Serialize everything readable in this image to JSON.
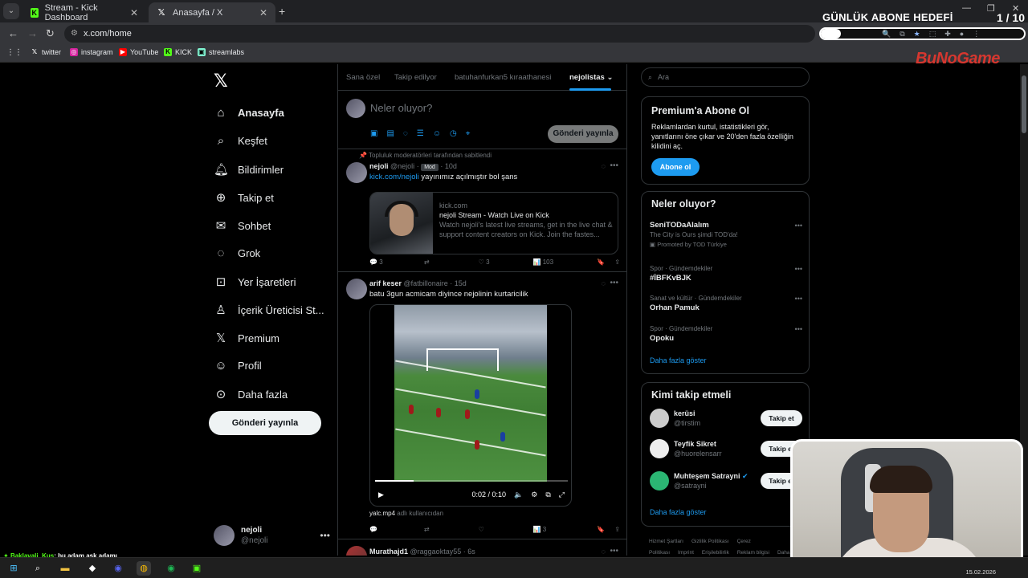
{
  "browser": {
    "tabs": [
      {
        "title": "Stream - Kick Dashboard",
        "favicon": "kick-icon"
      },
      {
        "title": "Anasayfa / X",
        "favicon": "x-icon"
      }
    ],
    "url": "x.com/home",
    "bookmarks": [
      "twitter",
      "instagram",
      "YouTube",
      "KICK",
      "streamlabs"
    ]
  },
  "overlay": {
    "goal_title": "GÜNLÜK ABONE HEDEFİ",
    "goal_count": "1 / 10",
    "goal_progress": 0.1,
    "brand": "BuNoGame",
    "chat_user": "Baklavali_Kus",
    "chat_message": ": bu adam aşk adamı"
  },
  "nav": {
    "items": [
      {
        "label": "Anasayfa",
        "icon": "home-icon"
      },
      {
        "label": "Keşfet",
        "icon": "search-icon"
      },
      {
        "label": "Bildirimler",
        "icon": "bell-icon"
      },
      {
        "label": "Takip et",
        "icon": "follow-icon"
      },
      {
        "label": "Sohbet",
        "icon": "mail-icon"
      },
      {
        "label": "Grok",
        "icon": "grok-icon"
      },
      {
        "label": "Yer İşaretleri",
        "icon": "bookmark-icon"
      },
      {
        "label": "İçerik Üreticisi St...",
        "icon": "creator-icon"
      },
      {
        "label": "Premium",
        "icon": "x-premium-icon"
      },
      {
        "label": "Profil",
        "icon": "person-icon"
      },
      {
        "label": "Daha fazla",
        "icon": "more-circle-icon"
      }
    ],
    "post_button": "Gönderi yayınla",
    "me_name": "nejoli",
    "me_handle": "@nejoli"
  },
  "feed": {
    "tabs": [
      "Sana özel",
      "Takip edilyor",
      "batuhanfurkan5 kıraathanesi",
      "nejolistas"
    ],
    "composer_placeholder": "Neler oluyor?",
    "composer_button": "Gönderi yayınla",
    "tweet1": {
      "pinned": "Topluluk moderatörleri tarafından sabitlendi",
      "name": "nejoli",
      "handle": "@nejoli",
      "badge": "Mod",
      "time": "· 10d",
      "link": "kick.com/nejoli",
      "text": " yayınımız açılmıştır bol şans",
      "card_domain": "kick.com",
      "card_title": "nejoli Stream - Watch Live on Kick",
      "card_desc": "Watch nejoli's latest live streams, get in the live chat & support content creators on Kick. Join the fastes...",
      "replies": "3",
      "reposts": "",
      "likes": "3",
      "views": "103"
    },
    "tweet2": {
      "name": "arif keser",
      "handle": "@fatbillonaire",
      "time": "· 15d",
      "text": "batu 3gun acmicam diyince nejolinin kurtaricilik",
      "video_time": "0:02 / 0:10",
      "video_progress": 0.2,
      "caption_file": "yalc.mp4",
      "caption_rest": " adlı kullanıcıdan",
      "replies": "",
      "reposts": "",
      "likes": "",
      "views": "3"
    },
    "tweet3": {
      "name": "Murathajd1",
      "handle": "@raggaoktay55",
      "time": "· 6s"
    }
  },
  "right": {
    "search_placeholder": "Ara",
    "premium_title": "Premium'a Abone Ol",
    "premium_text": "Reklamlardan kurtul, istatistikleri gör, yanıtlarını öne çıkar ve 20'den fazla özelliğin kilidini aç.",
    "premium_button": "Abone ol",
    "trends_title": "Neler oluyor?",
    "trends": [
      {
        "meta": "",
        "title": "SeniTODaAlalım",
        "sub": "The City is Ours şimdi TOD'da!",
        "promo": "Promoted by TOD Türkiye"
      },
      {
        "meta": "Spor · Gündemdekiler",
        "title": "#İBFKvBJK",
        "sub": "",
        "promo": ""
      },
      {
        "meta": "Sanat ve kültür · Gündemdekiler",
        "title": "Orhan Pamuk",
        "sub": "",
        "promo": ""
      },
      {
        "meta": "Spor · Gündemdekiler",
        "title": "Opoku",
        "sub": "",
        "promo": ""
      }
    ],
    "trends_more": "Daha fazla göster",
    "wtf_title": "Kimi takip etmeli",
    "wtf": [
      {
        "name": "kerüsi",
        "handle": "@tirstim",
        "button": "Takip et"
      },
      {
        "name": "Teyfik Sikret",
        "handle": "@huorelensarr",
        "button": "Takip et"
      },
      {
        "name": "Muhteşem Satrayni",
        "handle": "@satrayni",
        "button": "Takip et"
      }
    ],
    "wtf_more": "Daha fazla göster",
    "footer": [
      "Hizmet Şartları",
      "Gizlilik Politikası",
      "Çerez Politikası",
      "Imprint",
      "Erişilebilirlik",
      "Reklam bilgisi",
      "Daha fazla"
    ]
  },
  "taskbar": {
    "date": "15.02.2026"
  },
  "colors": {
    "accent": "#1d9bf0",
    "kick_green": "#53fc18",
    "background": "#000000"
  }
}
